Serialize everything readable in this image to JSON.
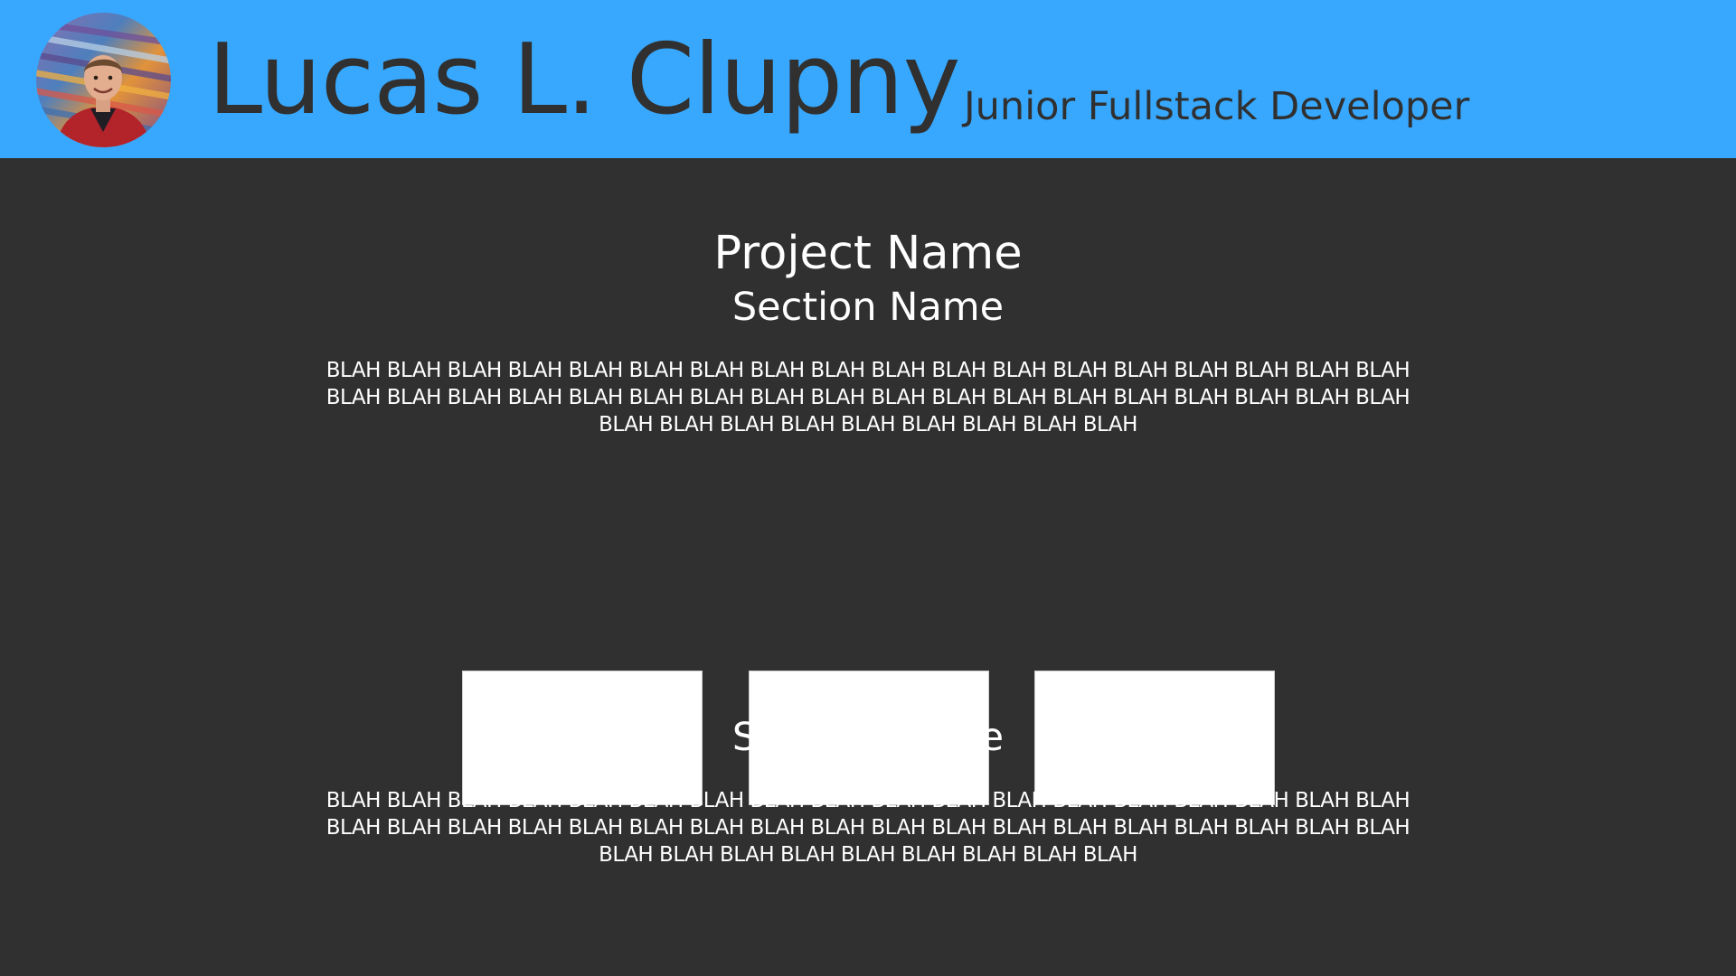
{
  "header": {
    "name": "Lucas L. Clupny",
    "role": "Junior Fullstack Developer",
    "background_color": "#38a8fe",
    "avatar_icon": "profile-photo"
  },
  "main": {
    "project_title": "Project Name",
    "sections": [
      {
        "title": "Section Name",
        "text": "BLAH BLAH BLAH BLAH BLAH BLAH BLAH BLAH BLAH BLAH BLAH BLAH BLAH BLAH BLAH BLAH BLAH BLAH BLAH BLAH BLAH BLAH BLAH BLAH BLAH BLAH BLAH BLAH BLAH BLAH BLAH BLAH BLAH BLAH BLAH BLAH BLAH BLAH BLAH BLAH BLAH BLAH BLAH BLAH BLAH"
      },
      {
        "title": "Section Name",
        "text": "BLAH BLAH BLAH BLAH BLAH BLAH BLAH BLAH BLAH BLAH BLAH BLAH BLAH BLAH BLAH BLAH BLAH BLAH BLAH BLAH BLAH BLAH BLAH BLAH BLAH BLAH BLAH BLAH BLAH BLAH BLAH BLAH BLAH BLAH BLAH BLAH BLAH BLAH BLAH BLAH BLAH BLAH BLAH BLAH BLAH"
      }
    ],
    "background_color": "#303030"
  }
}
